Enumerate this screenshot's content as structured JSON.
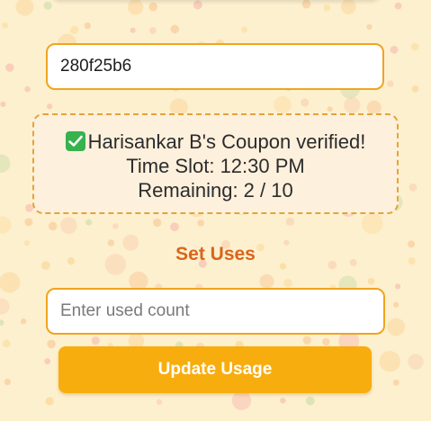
{
  "coupon_code_input": {
    "value": "280f25b6"
  },
  "verification": {
    "message": "Harisankar B's Coupon verified!",
    "time_slot": "Time Slot: 12:30 PM",
    "remaining": "Remaining: 2 / 10",
    "status_icon": "check-mark-icon",
    "status_color": "#37b24d"
  },
  "set_uses": {
    "title": "Set Uses",
    "count_placeholder": "Enter used count",
    "update_label": "Update Usage"
  },
  "colors": {
    "accent": "#f8ad0e",
    "title": "#d9651b",
    "border": "#f0a41f",
    "background": "#fdf0cf"
  }
}
